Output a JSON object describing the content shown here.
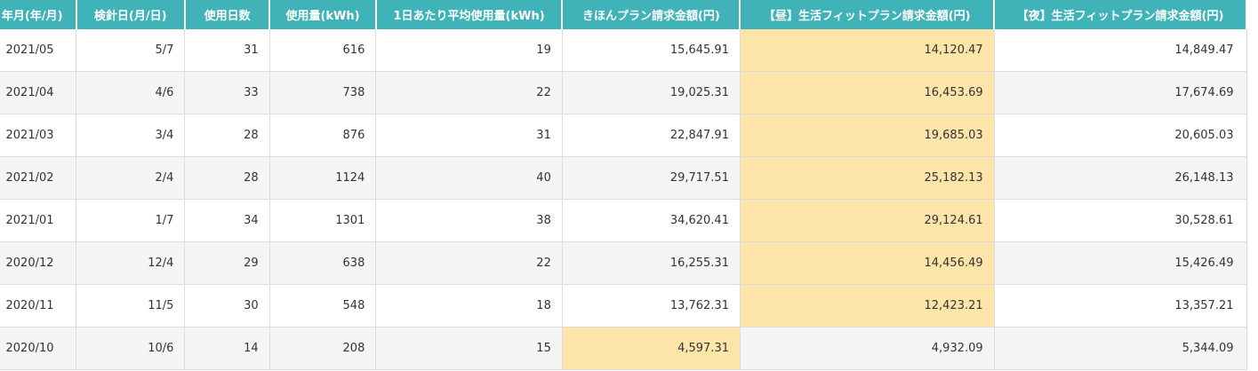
{
  "table": {
    "headers": [
      "年月(年/月)",
      "検針日(月/日)",
      "使用日数",
      "使用量(kWh)",
      "1日あたり平均使用量(kWh)",
      "きほんプラン請求金額(円)",
      "【昼】生活フィットプラン請求金額(円)",
      "【夜】生活フィットプラン請求金額(円)"
    ],
    "rows": [
      [
        "2021/05",
        "5/7",
        "31",
        "616",
        "19",
        "15,645.91",
        "14,120.47",
        "14,849.47"
      ],
      [
        "2021/04",
        "4/6",
        "33",
        "738",
        "22",
        "19,025.31",
        "16,453.69",
        "17,674.69"
      ],
      [
        "2021/03",
        "3/4",
        "28",
        "876",
        "31",
        "22,847.91",
        "19,685.03",
        "20,605.03"
      ],
      [
        "2021/02",
        "2/4",
        "28",
        "1124",
        "40",
        "29,717.51",
        "25,182.13",
        "26,148.13"
      ],
      [
        "2021/01",
        "1/7",
        "34",
        "1301",
        "38",
        "34,620.41",
        "29,124.61",
        "30,528.61"
      ],
      [
        "2020/12",
        "12/4",
        "29",
        "638",
        "22",
        "16,255.31",
        "14,456.49",
        "15,426.49"
      ],
      [
        "2020/11",
        "11/5",
        "30",
        "548",
        "18",
        "13,762.31",
        "12,423.21",
        "13,357.21"
      ],
      [
        "2020/10",
        "10/6",
        "14",
        "208",
        "15",
        "4,597.31",
        "4,932.09",
        "5,344.09"
      ]
    ],
    "highlight_cells": [
      {
        "row": 0,
        "col": 6
      },
      {
        "row": 1,
        "col": 6
      },
      {
        "row": 2,
        "col": 6
      },
      {
        "row": 3,
        "col": 6
      },
      {
        "row": 4,
        "col": 6
      },
      {
        "row": 5,
        "col": 6
      },
      {
        "row": 6,
        "col": 6
      },
      {
        "row": 7,
        "col": 5
      }
    ],
    "colors": {
      "header_bg": "#3fb3b8",
      "header_text": "#ffffff",
      "highlight_bg": "#fde4a8",
      "alt_row_bg": "#f5f5f5",
      "grid_line": "#dcdcdc"
    }
  }
}
